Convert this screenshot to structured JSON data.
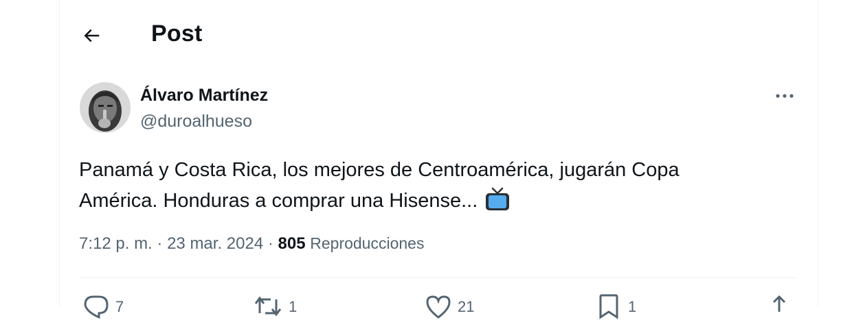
{
  "header": {
    "title": "Post"
  },
  "post": {
    "author_name": "Álvaro Martínez",
    "author_handle": "@duroalhueso",
    "text_line1": "Panamá y Costa Rica, los mejores de Centroamérica, jugarán Copa",
    "text_line2": "América. Honduras a comprar una Hisense...",
    "emoji": "television-icon",
    "time": "7:12 p. m.",
    "separator": "·",
    "date": "23 mar. 2024",
    "views_count": "805",
    "views_label": "Reproducciones"
  },
  "actions": {
    "reply_count": "7",
    "repost_count": "1",
    "like_count": "21",
    "bookmark_count": "1"
  },
  "icons": {
    "back": "arrow-left-icon",
    "more": "more-horizontal-icon",
    "reply": "reply-icon",
    "repost": "repost-icon",
    "like": "heart-icon",
    "bookmark": "bookmark-icon",
    "share": "share-icon"
  },
  "colors": {
    "text_primary": "#0f1419",
    "text_secondary": "#536471",
    "border": "#eff3f4"
  }
}
